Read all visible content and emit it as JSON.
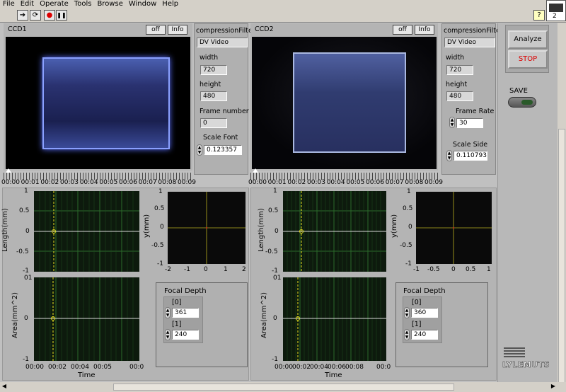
{
  "menu": [
    "File",
    "Edit",
    "Operate",
    "Tools",
    "Browse",
    "Window",
    "Help"
  ],
  "toolbar": {
    "run": "➔",
    "run_cont": "⟳",
    "abort": "●",
    "pause": "❚❚",
    "help": "?"
  },
  "corner_badge": "2",
  "cam1": {
    "title": "CCD1",
    "off": "off",
    "info": "Info",
    "compression_label": "compressionFilter",
    "compression_value": "DV Video",
    "width_label": "width",
    "width_value": "720",
    "height_label": "height",
    "height_value": "480",
    "frame_label": "Frame number",
    "frame_value": "0",
    "scale_label": "Scale Font",
    "scale_value": "0.123357"
  },
  "cam2": {
    "title": "CCD2",
    "off": "off",
    "info": "Info",
    "compression_label": "compressionFilter",
    "compression_value": "DV Video",
    "width_label": "width",
    "width_value": "720",
    "height_label": "height",
    "height_value": "480",
    "rate_label": "Frame Rate",
    "rate_value": "30",
    "scale_label": "Scale Side",
    "scale_value": "0.110793"
  },
  "timeline_ticks": [
    "00:00",
    "00:01",
    "00:02",
    "00:03",
    "00:04",
    "00:05",
    "00:06",
    "00:07",
    "00:08",
    "00:09"
  ],
  "right_panel": {
    "analyze": "Analyze",
    "stop": "STOP",
    "save": "SAVE",
    "logo": "LYLEMUTS"
  },
  "left": {
    "length_chart": {
      "ylabel": "Length(mm)",
      "yticks": [
        "1",
        "0.5",
        "0",
        "-0.5",
        "-1"
      ]
    },
    "area_chart": {
      "ylabel": "Area(mm^2)",
      "yticks": [
        "01",
        "0",
        "-1"
      ],
      "xticks": [
        "00:00",
        "00:02",
        "00:04",
        "00:05",
        "00:0"
      ],
      "xlabel": "Time"
    },
    "xy_chart": {
      "ylabel": "y(mm)",
      "yticks": [
        "1",
        "0.5",
        "0",
        "-0.5",
        "-1"
      ],
      "xticks": [
        "-2",
        "-1",
        "0",
        "1",
        "2"
      ]
    },
    "focal": {
      "title": "Focal Depth",
      "i0": "[0]",
      "v0": "361",
      "i1": "[1]",
      "v1": "240"
    }
  },
  "right": {
    "length_chart": {
      "ylabel": "Length(mm)",
      "yticks": [
        "1",
        "0.5",
        "0",
        "-0.5",
        "-1"
      ]
    },
    "area_chart": {
      "ylabel": "Area(mm^2)",
      "yticks": [
        "01",
        "0",
        "-1"
      ],
      "xticks": [
        "00:00",
        "00:02",
        "00:04",
        "00:06",
        "00:08",
        "00:0"
      ],
      "xlabel": "Time"
    },
    "xy_chart": {
      "ylabel": "y(mm)",
      "yticks": [
        "1",
        "0.5",
        "0",
        "-0.5",
        "-1"
      ],
      "xticks": [
        "-1",
        "-0.5",
        "0",
        "0.5",
        "1"
      ]
    },
    "focal": {
      "title": "Focal Depth",
      "i0": "[0]",
      "v0": "360",
      "i1": "[1]",
      "v1": "240"
    }
  }
}
